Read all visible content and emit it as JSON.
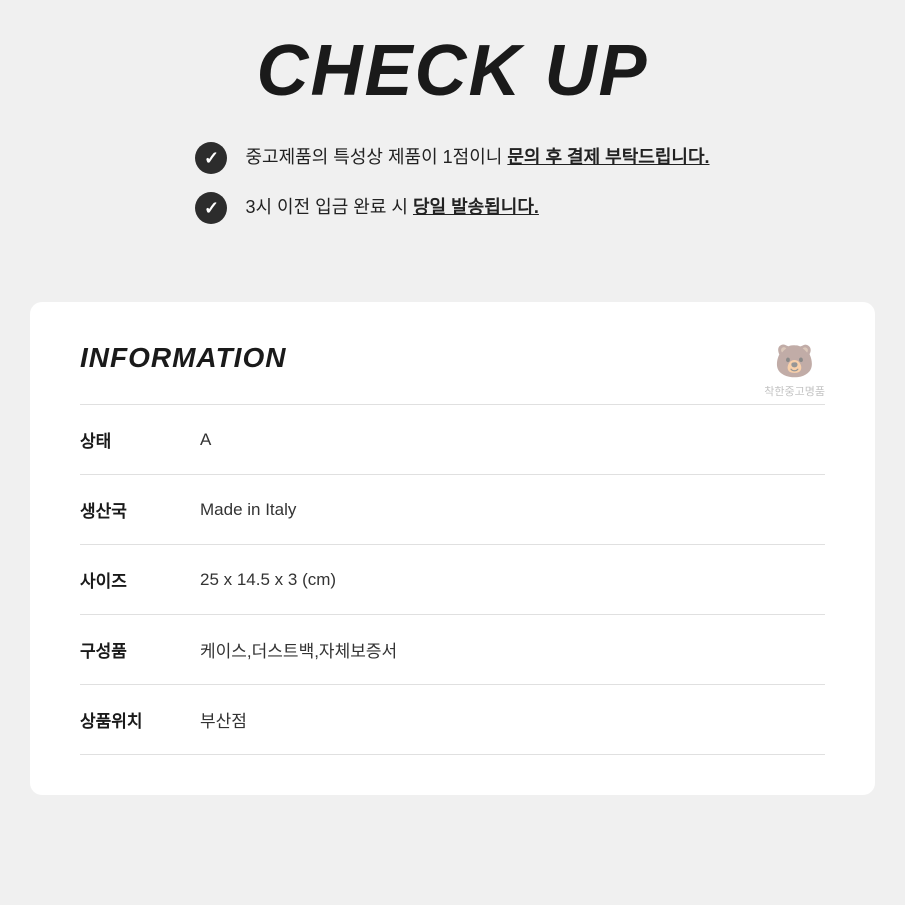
{
  "checkup": {
    "title": "CHECK UP",
    "items": [
      {
        "text_normal": "중고제품의 특성상 제품이 1점이니 ",
        "text_bold": "문의 후 결제 부탁드립니다."
      },
      {
        "text_normal": "3시 이전 입금 완료 시 ",
        "text_bold": "당일 발송됩니다."
      }
    ]
  },
  "information": {
    "section_title": "INFORMATION",
    "brand_watermark": "착한중고명품",
    "rows": [
      {
        "label": "상태",
        "value": "A"
      },
      {
        "label": "생산국",
        "value": "Made in Italy"
      },
      {
        "label": "사이즈",
        "value": "25 x 14.5 x 3 (cm)"
      },
      {
        "label": "구성품",
        "value": "케이스,더스트백,자체보증서"
      },
      {
        "label": "상품위치",
        "value": "부산점"
      }
    ]
  }
}
